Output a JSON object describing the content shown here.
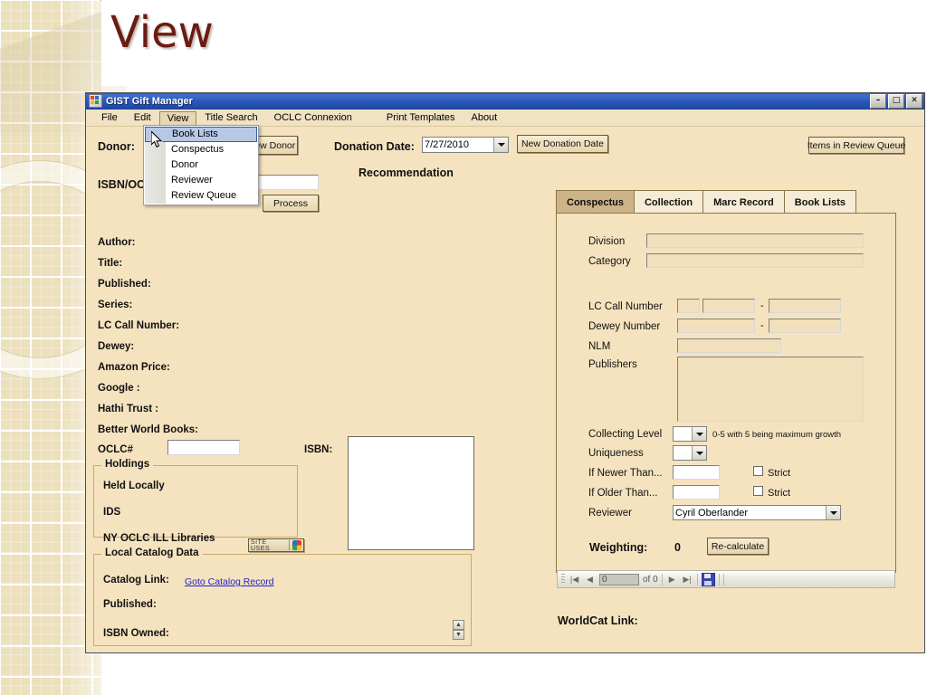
{
  "slide": {
    "title": "View"
  },
  "window": {
    "title": "GIST Gift Manager",
    "icon": "app-icon",
    "minimize": "–",
    "maximize": "□",
    "close": "✕"
  },
  "menubar": {
    "items": [
      {
        "label": "File"
      },
      {
        "label": "Edit"
      },
      {
        "label": "View"
      },
      {
        "label": "Title Search"
      },
      {
        "label": "OCLC Connexion"
      },
      {
        "label": "Print Templates"
      },
      {
        "label": "About"
      }
    ],
    "open_menu": "View"
  },
  "view_menu": {
    "items": [
      {
        "label": "Book Lists",
        "selected": true
      },
      {
        "label": "Conspectus",
        "selected": false
      },
      {
        "label": "Donor",
        "selected": false
      },
      {
        "label": "Reviewer",
        "selected": false
      },
      {
        "label": "Review Queue",
        "selected": false
      }
    ]
  },
  "header": {
    "donor_label": "Donor:",
    "new_donor_button": "New Donor",
    "isbn_oclc_label": "ISBN/OCLC",
    "isbn_oclc_value": "",
    "process_button": "Process",
    "donation_date_label": "Donation Date:",
    "donation_date_value": "7/27/2010",
    "new_donation_date_button": "New Donation Date",
    "recommendation_label": "Recommendation",
    "items_in_review_queue_button": "Items in Review Queue"
  },
  "details": {
    "fields": [
      {
        "label": "Author:",
        "value": ""
      },
      {
        "label": "Title:",
        "value": ""
      },
      {
        "label": "Published:",
        "value": ""
      },
      {
        "label": "Series:",
        "value": ""
      },
      {
        "label": "LC Call Number:",
        "value": ""
      },
      {
        "label": "Dewey:",
        "value": ""
      },
      {
        "label": "Amazon Price:",
        "value": ""
      },
      {
        "label": "Google :",
        "value": ""
      },
      {
        "label": "Hathi Trust :",
        "value": ""
      },
      {
        "label": "Better World Books:",
        "value": ""
      }
    ],
    "oclc_label": "OCLC#",
    "oclc_value": "",
    "isbn_label": "ISBN:",
    "isbn_image": ""
  },
  "holdings": {
    "title": "Holdings",
    "rows": [
      {
        "label": "Held Locally",
        "value": ""
      },
      {
        "label": "IDS",
        "value": ""
      },
      {
        "label": "NY OCLC ILL Libraries",
        "value": ""
      }
    ],
    "site_uses_button": "SITE USES",
    "site_uses_icon": "colored-squares-icon"
  },
  "local_catalog": {
    "title": "Local Catalog Data",
    "catalog_link_label": "Catalog Link:",
    "catalog_link_text": "Goto Catalog Record",
    "published_label": "Published:",
    "isbn_owned_label": "ISBN Owned:",
    "spinner_up": "▲",
    "spinner_down": "▼"
  },
  "tabs": [
    {
      "label": "Conspectus",
      "active": true
    },
    {
      "label": "Collection",
      "active": false
    },
    {
      "label": "Marc Record",
      "active": false
    },
    {
      "label": "Book Lists",
      "active": false
    }
  ],
  "conspectus": {
    "division_label": "Division",
    "division_value": "",
    "category_label": "Category",
    "category_value": "",
    "lc_call_label": "LC Call Number",
    "lc_call_prefix": "",
    "lc_call_from": "",
    "lc_call_dash": "-",
    "lc_call_to": "",
    "dewey_label": "Dewey Number",
    "dewey_from": "",
    "dewey_dash": "-",
    "dewey_to": "",
    "nlm_label": "NLM",
    "nlm_value": "",
    "publishers_label": "Publishers",
    "publishers_value": "",
    "collecting_level_label": "Collecting Level",
    "collecting_level_value": "",
    "collecting_level_hint": "0-5 with 5 being maximum growth",
    "uniqueness_label": "Uniqueness",
    "uniqueness_value": "",
    "if_newer_label": "If Newer Than...",
    "if_newer_value": "",
    "if_newer_strict_label": "Strict",
    "if_older_label": "If Older Than...",
    "if_older_value": "",
    "if_older_strict_label": "Strict",
    "reviewer_label": "Reviewer",
    "reviewer_value": "Cyril Oberlander",
    "weighting_label": "Weighting:",
    "weighting_value": "0",
    "recalculate_button": "Re-calculate"
  },
  "recordnav": {
    "first": "|◀",
    "prev": "◀",
    "position": "0",
    "of_label": "of 0",
    "next": "▶",
    "last": "▶|",
    "save_icon": "save-disk-icon"
  },
  "worldcat": {
    "label": "WorldCat Link:",
    "value": ""
  },
  "colors": {
    "window_face": "#f5e3bf",
    "titlebar": "#2a57b6",
    "accent_border": "#6b5a32",
    "tab_active": "#cdb388",
    "link": "#2222cc",
    "slide_title": "#6b1c11"
  }
}
